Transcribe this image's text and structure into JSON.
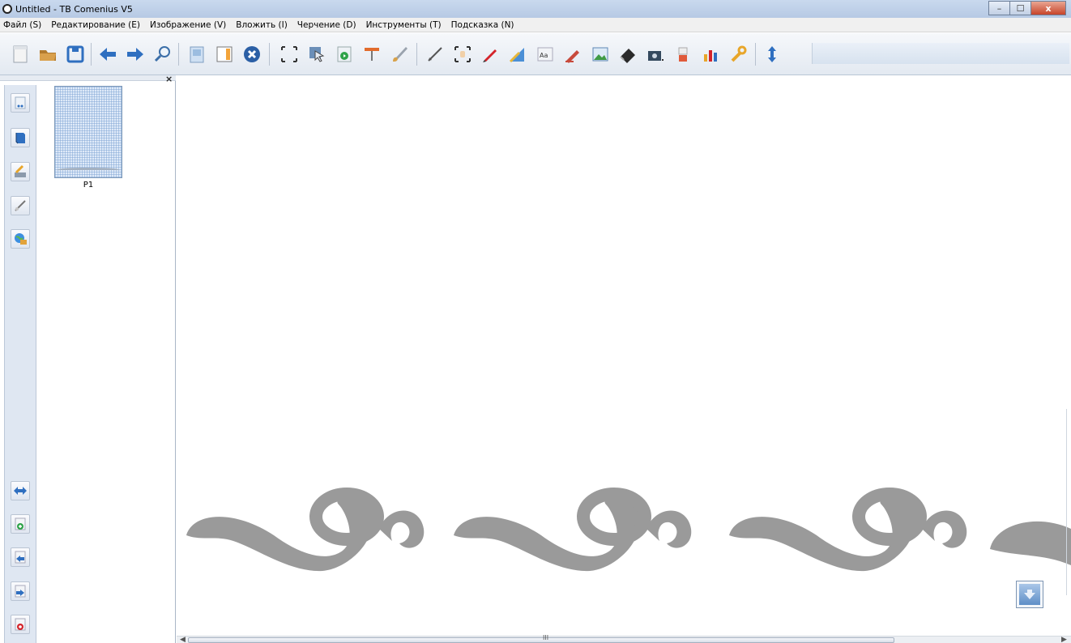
{
  "window": {
    "title": "Untitled - TB Comenius V5",
    "minimize": "–",
    "maximize": "☐",
    "close": "x"
  },
  "menu": [
    "Файл (S)",
    "Редактирование (E)",
    "Изображение (V)",
    "Вложить (I)",
    "Черчение (D)",
    "Инструменты (T)",
    "Подсказка (N)"
  ],
  "toolbar": {
    "icons": [
      "new-page-icon",
      "open-folder-icon",
      "save-icon",
      "back-arrow-icon",
      "forward-arrow-icon",
      "zoom-icon",
      "page-icon",
      "copy-page-icon",
      "delete-icon",
      "select-area-icon",
      "pointer-icon",
      "record-icon",
      "curtain-icon",
      "brush-icon",
      "line-icon",
      "hand-select-icon",
      "pen-icon",
      "ruler-icon",
      "text-icon",
      "highlighter-icon",
      "image-icon",
      "eraser-icon",
      "camera-icon",
      "paint-icon",
      "chart-icon",
      "tools-icon",
      "vertical-resize-icon"
    ]
  },
  "left_panel": {
    "close_label": "×",
    "page_label": "P1",
    "side_tools": [
      "page-template-icon",
      "book-icon",
      "tools-brush-icon",
      "brush-link-icon",
      "globe-icon",
      "swap-arrows-icon",
      "add-page-icon",
      "prev-page-icon",
      "next-page-icon",
      "delete-page-icon"
    ]
  },
  "scrollbar": {
    "grip": "III"
  },
  "colors": {
    "accent": "#2f6fc0",
    "staff_line": "#9a9a9a",
    "clef": "#9a9a9a",
    "panel_bg": "#dfe7f2"
  }
}
